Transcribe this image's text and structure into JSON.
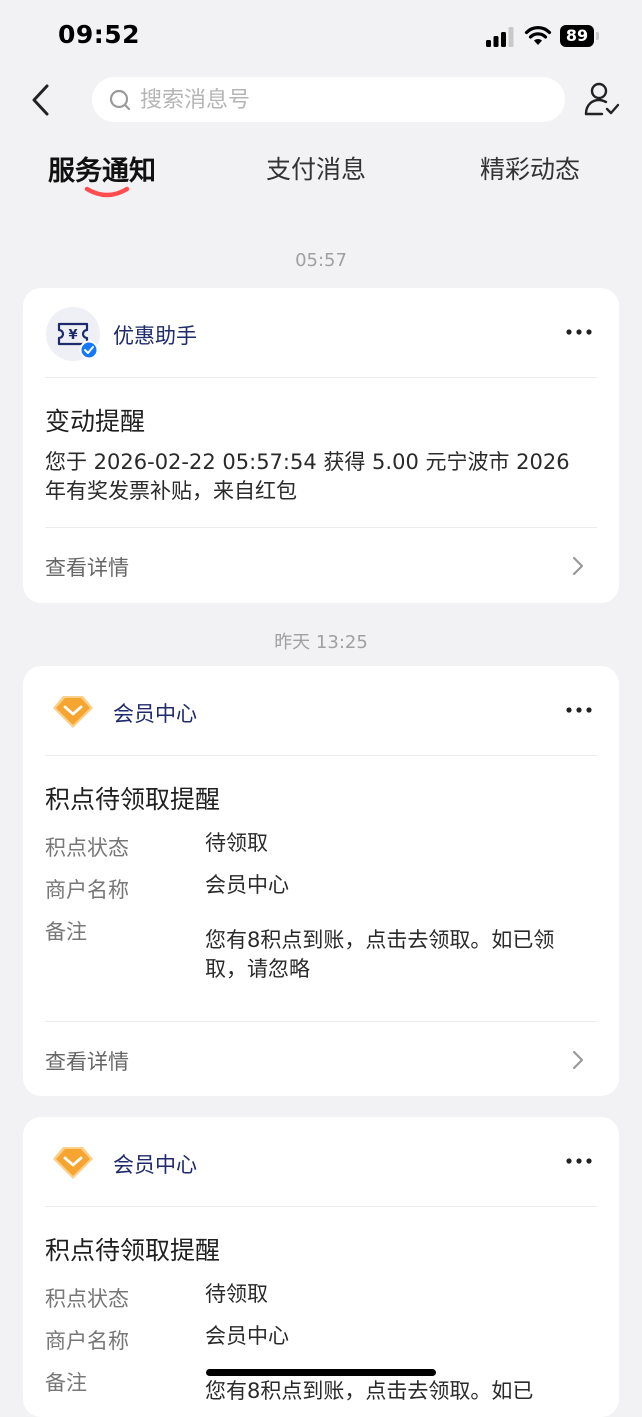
{
  "status_bar": {
    "time": "09:52",
    "battery": "89"
  },
  "search": {
    "placeholder": "搜索消息号"
  },
  "tabs": [
    {
      "label": "服务通知",
      "active": true
    },
    {
      "label": "支付消息",
      "active": false
    },
    {
      "label": "精彩动态",
      "active": false
    }
  ],
  "messages": [
    {
      "timestamp": "05:57",
      "sender": "优惠助手",
      "title": "变动提醒",
      "body": "您于 2026-02-22 05:57:54 获得 5.00 元宁波市 2026 年有奖发票补贴，来自红包",
      "detail_label": "查看详情"
    },
    {
      "timestamp": "昨天 13:25",
      "sender": "会员中心",
      "title": "积点待领取提醒",
      "fields": [
        {
          "label": "积点状态",
          "value": "待领取"
        },
        {
          "label": "商户名称",
          "value": "会员中心"
        },
        {
          "label": "备注",
          "value": "您有8积点到账，点击去领取。如已领取，请忽略"
        }
      ],
      "detail_label": "查看详情"
    },
    {
      "sender": "会员中心",
      "title": "积点待领取提醒",
      "fields": [
        {
          "label": "积点状态",
          "value": "待领取"
        },
        {
          "label": "商户名称",
          "value": "会员中心"
        },
        {
          "label": "备注",
          "value": "您有8积点到账，点击去领取。如已"
        }
      ]
    }
  ],
  "colors": {
    "accent_underline": "#ff4d4f",
    "sender_text": "#1e2a6b",
    "member_icon": "#f7a531",
    "verified_badge": "#1677ff"
  },
  "icons": [
    "back-icon",
    "search-icon",
    "user-settings-icon",
    "coupon-icon",
    "verified-badge-icon",
    "diamond-icon",
    "more-icon",
    "chevron-right-icon"
  ]
}
